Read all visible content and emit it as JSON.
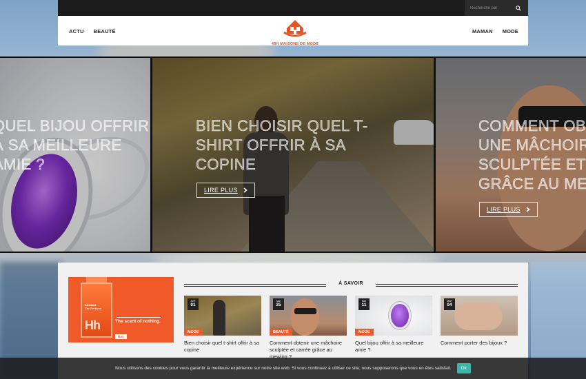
{
  "topbar": {
    "search_placeholder": "Recherche par"
  },
  "header": {
    "nav_left": [
      "ACTU",
      "BEAUTÉ"
    ],
    "nav_right": [
      "MAMAN",
      "MODE"
    ],
    "logo_text": "48H MAISONS DE MODE"
  },
  "slider": {
    "slides": [
      {
        "title": "QUEL BIJOU OFFRIR À SA MEILLEURE AMIE ?"
      },
      {
        "title": "BIEN CHOISIR QUEL T-SHIRT OFFRIR À SA COPINE",
        "button": "LIRE PLUS"
      },
      {
        "title": "COMMENT OBTENIR UNE MÂCHOIRE SCULPTÉE ET CARRÉE GRÂCE AU MEWING ?",
        "button": "LIRE PLUS"
      }
    ]
  },
  "ad": {
    "bottle_brand": "Hh",
    "bottle_label": "Abstract\nThe Perfume",
    "headline": "The scent of nothing.",
    "cta": "Buy"
  },
  "section": {
    "title": "À SAVOIR"
  },
  "cards": [
    {
      "month": "AVR",
      "day": "01",
      "category": "MODE",
      "title": "Bien choisir quel t-shirt offrir à sa copine"
    },
    {
      "month": "MAI",
      "day": "25",
      "category": "BEAUTÉ",
      "title": "Comment obtenir une mâchoire sculptée et carrée grâce au mewing ?"
    },
    {
      "month": "MAI",
      "day": "11",
      "category": "MODE",
      "title": "Quel bijou offrir à sa meilleure amie ?"
    },
    {
      "month": "MAR",
      "day": "04",
      "category": "MODE",
      "title": "Comment porter des bijoux ?"
    }
  ],
  "cookie": {
    "text": "Nous utilisons des cookies pour vous garantir la meilleure expérience sur notre site web. Si vous continuez à utiliser ce site, nous supposerons que vous en êtes satisfait.",
    "ok": "Ok"
  },
  "colors": {
    "accent": "#f05a28",
    "dark": "#1b1b1b",
    "cookie_ok": "#3cb6a8"
  }
}
